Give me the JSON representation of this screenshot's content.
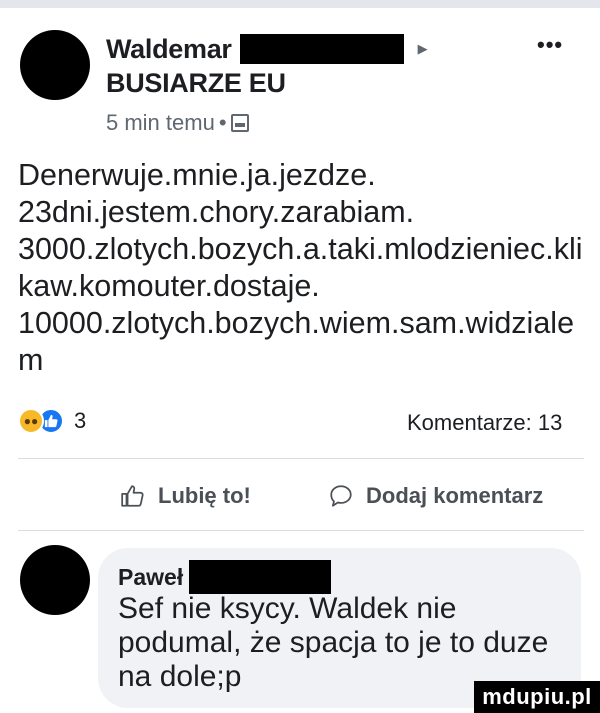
{
  "post": {
    "author": "Waldemar",
    "group": "BUSIARZE EU",
    "time": "5 min temu",
    "separator": "•",
    "more_label": "•••",
    "text_lines": [
      "Denerwuje.mnie.ja.jezdze.",
      "23dni.jestem.chory.zarabiam.",
      "3000.zlotych.bozych.a.taki.mlodzieniec.kli",
      "kaw.komouter.dostaje.",
      "10000.zlotych.bozych.wiem.sam.widziale",
      "m"
    ],
    "reaction_count": "3",
    "comments_label": "Komentarze: 13"
  },
  "actions": {
    "like": "Lubię to!",
    "comment": "Dodaj komentarz"
  },
  "comment": {
    "author": "Paweł",
    "text_lines": [
      "Sef nie ksycy. Waldek nie",
      "podumal, że spacja to je to duze",
      "na dole;p"
    ]
  },
  "watermark": "mdupiu.pl",
  "colors": {
    "like_blue": "#1877f2",
    "emoji_yellow": "#f7b928",
    "bubble_bg": "#f0f2f5"
  }
}
